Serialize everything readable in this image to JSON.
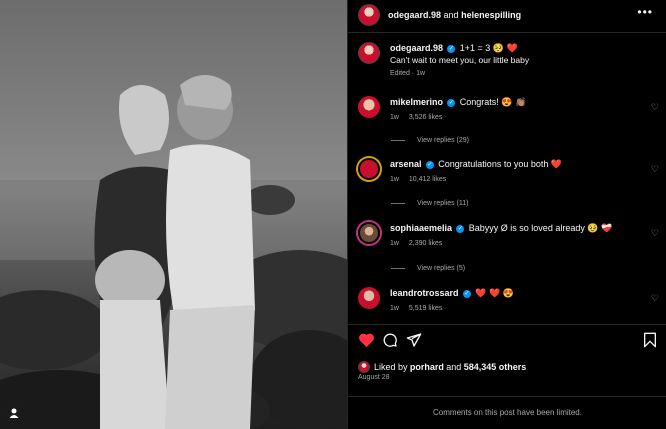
{
  "post": {
    "author": "odegaard.98",
    "collaborator": "helenespilling",
    "connector": "and",
    "more_icon": "more-horizontal-icon"
  },
  "caption": {
    "username": "odegaard.98",
    "text_line1": "1+1 = 3 🥺 ❤️",
    "text_line2": "Can't wait to meet you, our little baby",
    "edited": "Edited",
    "time": "1w"
  },
  "comments": [
    {
      "username": "mikelmerino",
      "text": "Congrats! 😍 👏🏽",
      "time": "1w",
      "likes": "3,526 likes",
      "replies": "View replies (29)"
    },
    {
      "username": "arsenal",
      "text": "Congratulations to you both ❤️",
      "time": "1w",
      "likes": "10,412 likes",
      "replies": "View replies (11)"
    },
    {
      "username": "sophiaaemelia",
      "text": "Babyyy Ø is so loved already 🥹 ❤️‍🩹",
      "time": "1w",
      "likes": "2,390 likes",
      "replies": "View replies (5)"
    },
    {
      "username": "leandrotrossard",
      "text": "❤️ ❤️ 😍",
      "time": "1w",
      "likes": "5,519 likes"
    }
  ],
  "footer": {
    "liked_by_prefix": "Liked by",
    "liked_user": "porhard",
    "liked_joiner": "and",
    "liked_count": "584,345 others",
    "date": "August 28",
    "limited_notice": "Comments on this post have been limited."
  },
  "colors": {
    "background": "#000000",
    "text": "#f5f5f5",
    "muted": "#a8a8a8",
    "like_red": "#ff3040",
    "verified_blue": "#0095f6"
  }
}
